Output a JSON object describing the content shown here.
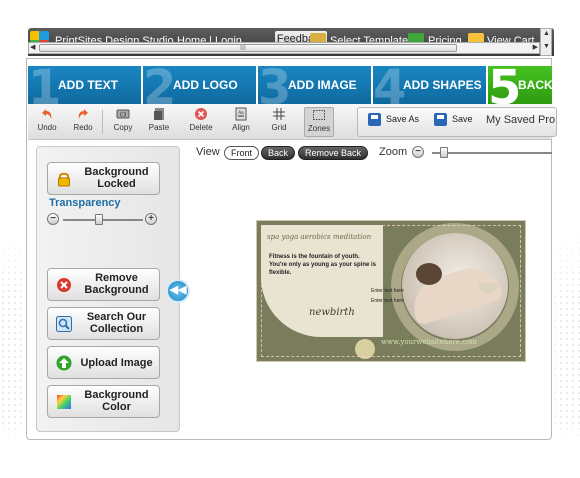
{
  "topbar": {
    "brand": "PrintSites Design Studio",
    "home": "Home",
    "sep": "|",
    "login": "Login",
    "feedback": "Feedback",
    "select_template": "Select Template",
    "pricing": "Pricing",
    "view_cart": "View Cart",
    "scroll_grip": "III"
  },
  "steps": [
    {
      "num": "1",
      "label": "ADD TEXT"
    },
    {
      "num": "2",
      "label": "ADD LOGO"
    },
    {
      "num": "3",
      "label": "ADD IMAGE"
    },
    {
      "num": "4",
      "label": "ADD SHAPES"
    },
    {
      "num": "5",
      "label": "BACKGR"
    }
  ],
  "toolbar": {
    "undo": "Undo",
    "redo": "Redo",
    "copy": "Copy",
    "paste": "Paste",
    "delete": "Delete",
    "align": "Align",
    "grid": "Grid",
    "zones": "Zones",
    "save_as": "Save As",
    "save": "Save",
    "my_saved": "My Saved Pro"
  },
  "left_panel": {
    "bg_locked": [
      "Background",
      "Locked"
    ],
    "transparency": "Transparency",
    "transparency_level": 0.45,
    "remove_bg": [
      "Remove",
      "Background"
    ],
    "search": [
      "Search Our",
      "Collection"
    ],
    "upload": "Upload Image",
    "bg_color": [
      "Background",
      "Color"
    ],
    "slider_minus": "−",
    "slider_plus": "+"
  },
  "viewbar": {
    "view": "View",
    "front": "Front",
    "back": "Back",
    "remove_back": "Remove Back",
    "zoom": "Zoom",
    "zoom_level": 0.1
  },
  "card": {
    "tagline": "spa  yoga  aerobics  meditation",
    "fitness": "Fitness is the  fountain of youth. You're only as young as your spine is flexible.",
    "brand": "newbirth",
    "website": "www.yourwebsitehere.com",
    "enter1": "Enter text here",
    "enter2": "Enter text here"
  },
  "colors": {
    "step_blue": "#1a86c2",
    "step_green": "#44c21f",
    "accent_blue": "#1e6fa8",
    "card_olive": "#7a7d5c"
  }
}
